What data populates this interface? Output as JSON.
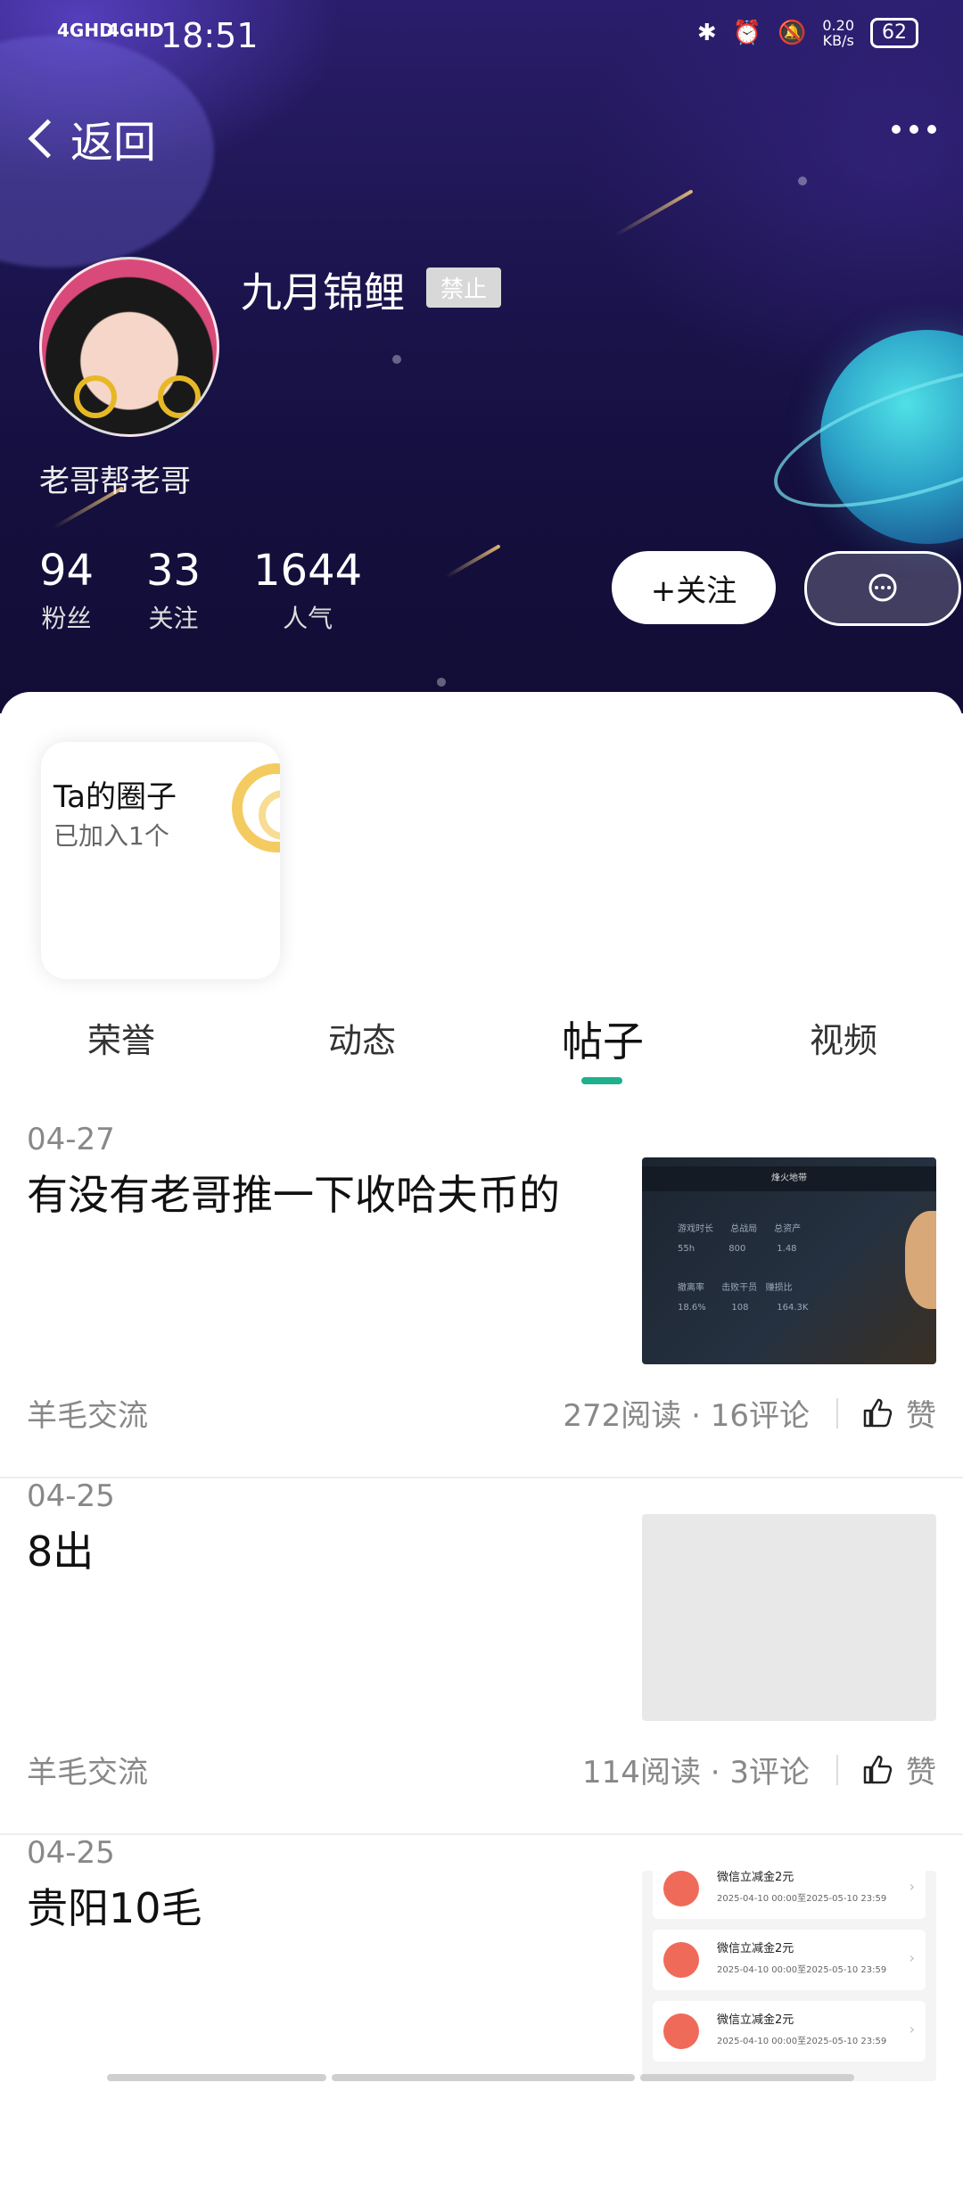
{
  "status_bar": {
    "signal1": "4GHD",
    "signal2": "4GHD",
    "time": "18:51",
    "net_speed_value": "0.20",
    "net_speed_unit": "KB/s",
    "battery": "62"
  },
  "nav": {
    "back_label": "返回"
  },
  "profile": {
    "nickname": "九月锦鲤",
    "badge": "禁止",
    "signature": "老哥帮老哥",
    "stats": [
      {
        "value": "94",
        "label": "粉丝"
      },
      {
        "value": "33",
        "label": "关注"
      },
      {
        "value": "1644",
        "label": "人气"
      }
    ],
    "follow_label": "+关注"
  },
  "circle": {
    "title": "Ta的圈子",
    "subtitle": "已加入1个"
  },
  "tabs": [
    {
      "label": "荣誉",
      "active": false
    },
    {
      "label": "动态",
      "active": false
    },
    {
      "label": "帖子",
      "active": true
    },
    {
      "label": "视频",
      "active": false
    }
  ],
  "posts": [
    {
      "date": "04-27",
      "title": "有没有老哥推一下收哈夫币的",
      "category": "羊毛交流",
      "stats": "272阅读 · 16评论",
      "like_label": "赞",
      "thumb": {
        "header": "烽火地带",
        "cells": [
          "游戏时长",
          "总战局",
          "总资产",
          "55h",
          "800",
          "1.48",
          "撤离率",
          "击败干员",
          "赚损比",
          "18.6%",
          "108",
          "164.3K"
        ]
      }
    },
    {
      "date": "04-25",
      "title": "8出",
      "category": "羊毛交流",
      "stats": "114阅读 · 3评论",
      "like_label": "赞"
    },
    {
      "date": "04-25",
      "title": "贵阳10毛",
      "coupons": [
        {
          "title": "微信立减金2元",
          "period": "2025-04-10 00:00至2025-05-10 23:59"
        },
        {
          "title": "微信立减金2元",
          "period": "2025-04-10 00:00至2025-05-10 23:59"
        },
        {
          "title": "微信立减金2元",
          "period": "2025-04-10 00:00至2025-05-10 23:59"
        }
      ]
    }
  ],
  "colors": {
    "accent": "#1fb08e",
    "header_bg": "#1d1550",
    "coupon_icon": "#f06a5a"
  }
}
